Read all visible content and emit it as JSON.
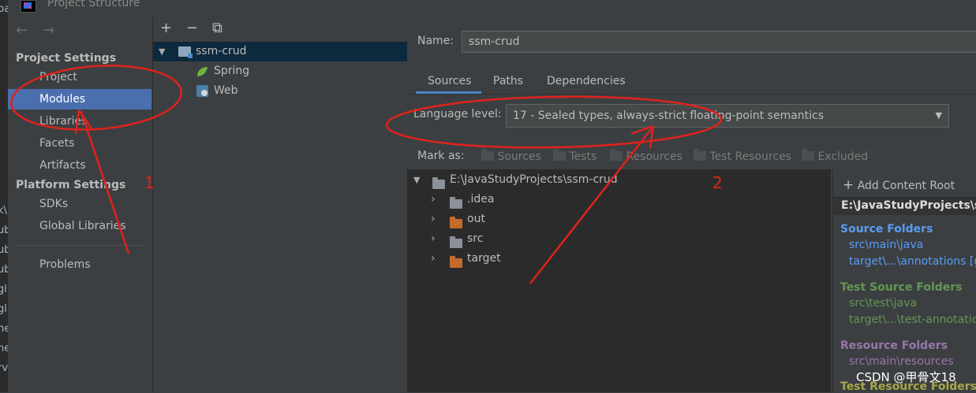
{
  "window": {
    "title": "Project Structure"
  },
  "bg_strip": [
    "pa",
    "k\\",
    "ub",
    "ub",
    "ub",
    "gl",
    "gl:",
    "ne",
    "ne",
    "rv"
  ],
  "sidebar": {
    "back": "←",
    "forward": "→",
    "project_settings_header": "Project Settings",
    "project_settings": [
      "Project",
      "Modules",
      "Libraries",
      "Facets",
      "Artifacts"
    ],
    "platform_settings_header": "Platform Settings",
    "platform_settings": [
      "SDKs",
      "Global Libraries"
    ],
    "problems": "Problems",
    "selected": "Modules"
  },
  "module_tree": {
    "toolbar": {
      "add": "+",
      "remove": "−",
      "copy": "⧉"
    },
    "root": "ssm-crud",
    "facets": [
      "Spring",
      "Web"
    ]
  },
  "module": {
    "name_label": "Name:",
    "name_value": "ssm-crud",
    "tabs": [
      "Sources",
      "Paths",
      "Dependencies"
    ],
    "active_tab": "Sources",
    "language_label": "Language level:",
    "language_value": "17 - Sealed types, always-strict floating-point semantics",
    "mark_as_label": "Mark as:",
    "mark_as": [
      "Sources",
      "Tests",
      "Resources",
      "Test Resources",
      "Excluded"
    ],
    "content_tree": {
      "root": "E:\\JavaStudyProjects\\ssm-crud",
      "children": [
        {
          "name": ".idea",
          "color": "#8a9199"
        },
        {
          "name": "out",
          "color": "#c36b2b"
        },
        {
          "name": "src",
          "color": "#8a9199"
        },
        {
          "name": "target",
          "color": "#c36b2b"
        }
      ]
    },
    "content_roots": {
      "add_label": "Add Content Root",
      "root_path": "E:\\JavaStudyProjects\\ssm",
      "groups": [
        {
          "title": "Source Folders",
          "items": [
            "src\\main\\java",
            "target\\...\\annotations [ge"
          ]
        },
        {
          "title": "Test Source Folders",
          "items": [
            "src\\test\\java",
            "target\\...\\test-annotation"
          ]
        },
        {
          "title": "Resource Folders",
          "items": [
            "src\\main\\resources"
          ]
        },
        {
          "title": "Test Resource Folders",
          "items": []
        }
      ]
    }
  },
  "annotations": {
    "num1": "1",
    "num2": "2",
    "color": "#e0221c"
  },
  "watermark": "CSDN @甲骨文18"
}
